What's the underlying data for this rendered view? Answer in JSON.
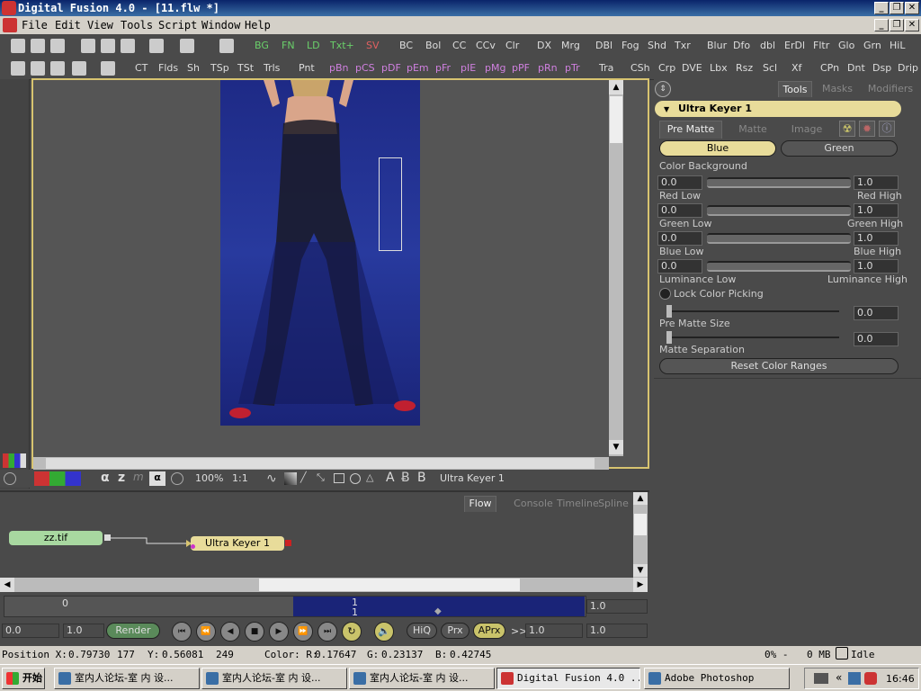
{
  "window": {
    "title": "Digital Fusion 4.0 - [11.flw *]"
  },
  "menu": [
    "File",
    "Edit",
    "View",
    "Tools",
    "Script",
    "Window",
    "Help"
  ],
  "toolbar1": {
    "icon_names": [
      "new-icon",
      "open-icon",
      "save-icon",
      "cut-icon",
      "copy-icon",
      "paste-icon",
      "undo-icon",
      "redo-icon",
      "delete-icon"
    ],
    "tools": [
      "BG",
      "FN",
      "LD",
      "Txt+",
      "SV",
      "BC",
      "Bol",
      "CC",
      "CCv",
      "Clr",
      "DX",
      "Mrg",
      "DBl",
      "Fog",
      "Shd",
      "Txr",
      "Blur",
      "Dfo",
      "dbl",
      "ErDl",
      "Fltr",
      "Glo",
      "Grn",
      "HiL"
    ]
  },
  "toolbar2": {
    "tools": [
      "CT",
      "Flds",
      "Sh",
      "TSp",
      "TSt",
      "Trls",
      "Pnt",
      "pBn",
      "pCS",
      "pDF",
      "pEm",
      "pFr",
      "pIE",
      "pMg",
      "pPF",
      "pRn",
      "pTr",
      "Tra",
      "CSh",
      "Crp",
      "DVE",
      "Lbx",
      "Rsz",
      "Scl",
      "Xf",
      "CPn",
      "Dnt",
      "Dsp",
      "Drip"
    ]
  },
  "viewer": {
    "zoom": "100%",
    "ratio": "1:1",
    "channel_letters": [
      "A",
      "B"
    ],
    "channel_buttons": [
      "α",
      "z",
      "m"
    ],
    "tool_name": "Ultra Keyer 1"
  },
  "panel": {
    "tabs": [
      "Tools",
      "Masks",
      "Modifiers"
    ],
    "tool_title": "Ultra Keyer 1",
    "subtabs": [
      "Pre Matte",
      "Matte",
      "Image"
    ],
    "color_options": [
      "Blue",
      "Green"
    ],
    "color_background_label": "Color Background",
    "ranges": [
      {
        "low_value": "0.0",
        "high_value": "1.0",
        "low_label": "Red Low",
        "high_label": "Red High"
      },
      {
        "low_value": "0.0",
        "high_value": "1.0",
        "low_label": "Green Low",
        "high_label": "Green High"
      },
      {
        "low_value": "0.0",
        "high_value": "1.0",
        "low_label": "Blue Low",
        "high_label": "Blue High"
      },
      {
        "low_value": "0.0",
        "high_value": "1.0",
        "low_label": "Luminance Low",
        "high_label": "Luminance High"
      }
    ],
    "lock_label": "Lock Color Picking",
    "pre_matte_size": {
      "label": "Pre Matte Size",
      "value": "0.0"
    },
    "matte_separation": {
      "label": "Matte Separation",
      "value": "0.0"
    },
    "reset_label": "Reset Color Ranges"
  },
  "flow": {
    "tabs": [
      "Flow",
      "Console",
      "Timeline",
      "Spline"
    ],
    "nodes": [
      "zz.tif",
      "Ultra Keyer 1"
    ]
  },
  "timeline": {
    "start": "0",
    "current": "1",
    "current_sub": "1",
    "end_value": "1.0",
    "in_value": "0.0",
    "len_value": "1.0"
  },
  "transport": {
    "render_label": "Render",
    "hiq": "HiQ",
    "prx": "Prx",
    "aprx": "APrx",
    "step": ">>",
    "step_value": "1.0",
    "end_value": "1.0"
  },
  "status": {
    "pos_x_label": "Position X:",
    "pos_x": "0.79730",
    "px": "177",
    "pos_y_label": "Y:",
    "pos_y": "0.56081",
    "py": "249",
    "color_label": "Color: R:",
    "r": "0.17647",
    "g_label": "G:",
    "g": "0.23137",
    "b_label": "B:",
    "b": "0.42745",
    "pct": "0% -",
    "mem": "0 MB",
    "state": "Idle"
  },
  "taskbar": {
    "start": "开始",
    "tasks": [
      "室内人论坛-室 内 设...",
      "室内人论坛-室 内 设...",
      "室内人论坛-室 内 设...",
      "Digital Fusion 4.0 ...",
      "Adobe Photoshop"
    ],
    "clock": "16:46"
  },
  "colors": {
    "accent": "#d8c470",
    "node_green": "#a8d8a0",
    "node_yellow": "#e8dc9a",
    "screen_blue": "#283a9e"
  }
}
